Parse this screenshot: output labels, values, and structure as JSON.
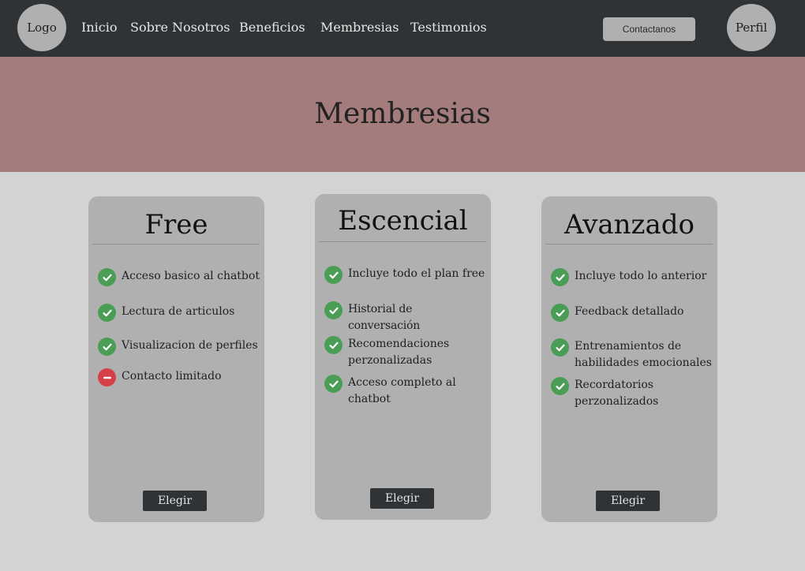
{
  "nav": {
    "logo": "Logo",
    "links": [
      "Inicio",
      "Sobre Nosotros",
      "Beneficios",
      "Membresias",
      "Testimonios"
    ],
    "contact": "Contactanos",
    "profile": "Perfil"
  },
  "hero": {
    "title": "Membresias"
  },
  "plans": [
    {
      "name": "Free",
      "features": [
        {
          "text": "Acceso basico al chatbot",
          "icon": "check-icon"
        },
        {
          "text": "Lectura de articulos",
          "icon": "check-icon"
        },
        {
          "text": "Visualizacion de perfiles",
          "icon": "check-icon"
        },
        {
          "text": "Contacto limitado",
          "icon": "minus-icon"
        }
      ],
      "button": "Elegir"
    },
    {
      "name": "Escencial",
      "features": [
        {
          "text": "Incluye todo el plan free",
          "icon": "check-icon"
        },
        {
          "text": "Historial de conversación",
          "icon": "check-icon"
        },
        {
          "text": "Recomendaciones perzonalizadas",
          "icon": "check-icon"
        },
        {
          "text": "Acceso completo al chatbot",
          "icon": "check-icon"
        }
      ],
      "button": "Elegir"
    },
    {
      "name": "Avanzado",
      "features": [
        {
          "text": "Incluye todo lo anterior",
          "icon": "check-icon"
        },
        {
          "text": "Feedback detallado",
          "icon": "check-icon"
        },
        {
          "text": "Entrenamientos de habilidades emocionales",
          "icon": "check-icon"
        },
        {
          "text": "Recordatorios perzonalizados",
          "icon": "check-icon"
        }
      ],
      "button": "Elegir"
    }
  ],
  "colors": {
    "navbar": "#2f3335",
    "hero": "#a47c7c",
    "background": "#d3d3d3",
    "card": "#b0b0b0",
    "check": "#4a9d54",
    "limited": "#d63f47"
  }
}
